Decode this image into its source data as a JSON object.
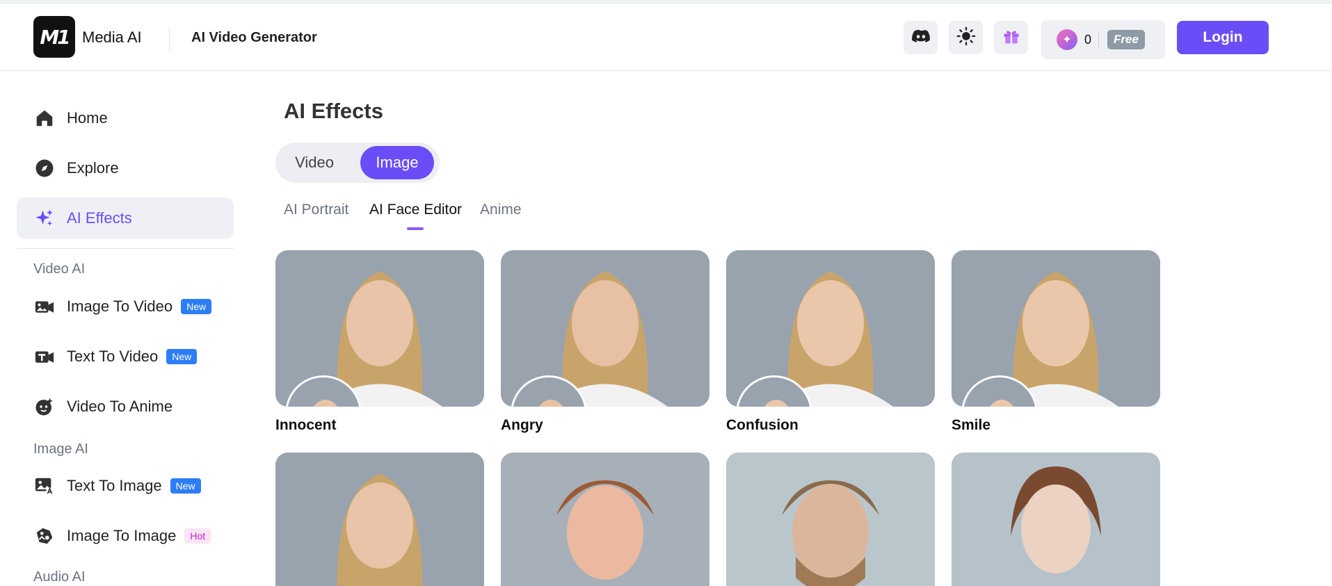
{
  "header": {
    "logo_text": "M1",
    "brand": "Media AI",
    "app_title": "AI Video Generator",
    "credits_count": "0",
    "plan_label": "Free",
    "login_label": "Login",
    "icons": [
      "discord-icon",
      "theme-sun-icon",
      "gift-icon",
      "credit-gem-icon"
    ],
    "accent_color": "#6a4df6"
  },
  "sidebar": {
    "items": [
      {
        "label": "Home",
        "icon": "home-icon"
      },
      {
        "label": "Explore",
        "icon": "compass-icon"
      },
      {
        "label": "AI Effects",
        "icon": "sparkle-icon",
        "active": true
      }
    ],
    "sections": [
      {
        "title": "Video AI",
        "items": [
          {
            "label": "Image To Video",
            "badge": "New",
            "icon": "image-to-video-icon"
          },
          {
            "label": "Text To Video",
            "badge": "New",
            "icon": "text-to-video-icon"
          },
          {
            "label": "Video To Anime",
            "icon": "anime-face-icon"
          }
        ]
      },
      {
        "title": "Image AI",
        "items": [
          {
            "label": "Text To Image",
            "badge": "New",
            "icon": "text-to-image-icon"
          },
          {
            "label": "Image To Image",
            "badge": "Hot",
            "icon": "image-to-image-icon"
          }
        ]
      },
      {
        "title": "Audio AI",
        "items": []
      }
    ]
  },
  "main": {
    "title": "AI Effects",
    "segments": [
      {
        "label": "Video",
        "active": false
      },
      {
        "label": "Image",
        "active": true
      }
    ],
    "tabs": [
      {
        "label": "AI Portrait",
        "active": false
      },
      {
        "label": "AI Face Editor",
        "active": true
      },
      {
        "label": "Anime",
        "active": false
      }
    ],
    "cards": [
      {
        "name": "Innocent"
      },
      {
        "name": "Angry"
      },
      {
        "name": "Confusion"
      },
      {
        "name": "Smile"
      },
      {
        "name": ""
      },
      {
        "name": ""
      },
      {
        "name": ""
      },
      {
        "name": ""
      }
    ]
  }
}
